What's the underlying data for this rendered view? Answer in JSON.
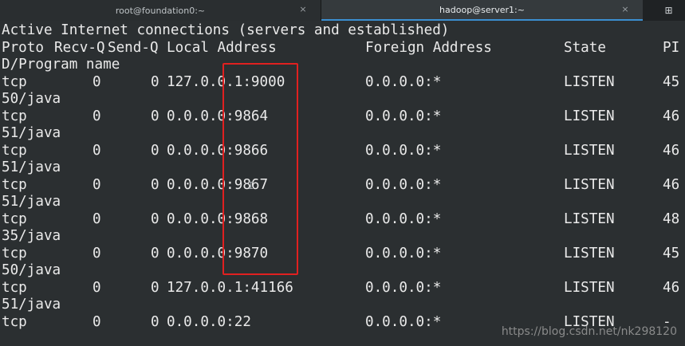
{
  "tabs": [
    {
      "title": "root@foundation0:~",
      "close": "×"
    },
    {
      "title": "hadoop@server1:~",
      "close": "×"
    }
  ],
  "new_tab_icon": "⊞",
  "terminal": {
    "heading": "Active Internet connections (servers and established)",
    "columns": {
      "proto": "Proto",
      "recvq": "Recv-Q",
      "sendq": "Send-Q",
      "local": "Local Address",
      "foreign": "Foreign Address",
      "state": "State",
      "pid_head": "PI",
      "pid_tail": "D/Program name"
    },
    "rows": [
      {
        "proto": "tcp",
        "recvq": "0",
        "sendq": "0",
        "local": "127.0.0.1:9000",
        "foreign": "0.0.0.0:*",
        "state": "LISTEN",
        "pid_head": "45",
        "pid_tail": "50/java"
      },
      {
        "proto": "tcp",
        "recvq": "0",
        "sendq": "0",
        "local": "0.0.0.0:9864",
        "foreign": "0.0.0.0:*",
        "state": "LISTEN",
        "pid_head": "46",
        "pid_tail": "51/java"
      },
      {
        "proto": "tcp",
        "recvq": "0",
        "sendq": "0",
        "local": "0.0.0.0:9866",
        "foreign": "0.0.0.0:*",
        "state": "LISTEN",
        "pid_head": "46",
        "pid_tail": "51/java"
      },
      {
        "proto": "tcp",
        "recvq": "0",
        "sendq": "0",
        "local": "0.0.0.0:9867",
        "foreign": "0.0.0.0:*",
        "state": "LISTEN",
        "pid_head": "46",
        "pid_tail": "51/java"
      },
      {
        "proto": "tcp",
        "recvq": "0",
        "sendq": "0",
        "local": "0.0.0.0:9868",
        "foreign": "0.0.0.0:*",
        "state": "LISTEN",
        "pid_head": "48",
        "pid_tail": "35/java"
      },
      {
        "proto": "tcp",
        "recvq": "0",
        "sendq": "0",
        "local": "0.0.0.0:9870",
        "foreign": "0.0.0.0:*",
        "state": "LISTEN",
        "pid_head": "45",
        "pid_tail": "50/java"
      },
      {
        "proto": "tcp",
        "recvq": "0",
        "sendq": "0",
        "local": "127.0.0.1:41166",
        "foreign": "0.0.0.0:*",
        "state": "LISTEN",
        "pid_head": "46",
        "pid_tail": "51/java"
      },
      {
        "proto": "tcp",
        "recvq": "0",
        "sendq": "0",
        "local": "0.0.0.0:22",
        "foreign": "0.0.0.0:*",
        "state": "LISTEN",
        "pid_head": "-",
        "pid_tail": ""
      }
    ]
  },
  "cursor_glyph": "I",
  "watermark": "https://blog.csdn.net/nk298120",
  "colors": {
    "background": "#2b2f31",
    "text": "#eaeaea",
    "highlight_box": "#e02020",
    "active_tab_accent": "#3b8fd1"
  }
}
